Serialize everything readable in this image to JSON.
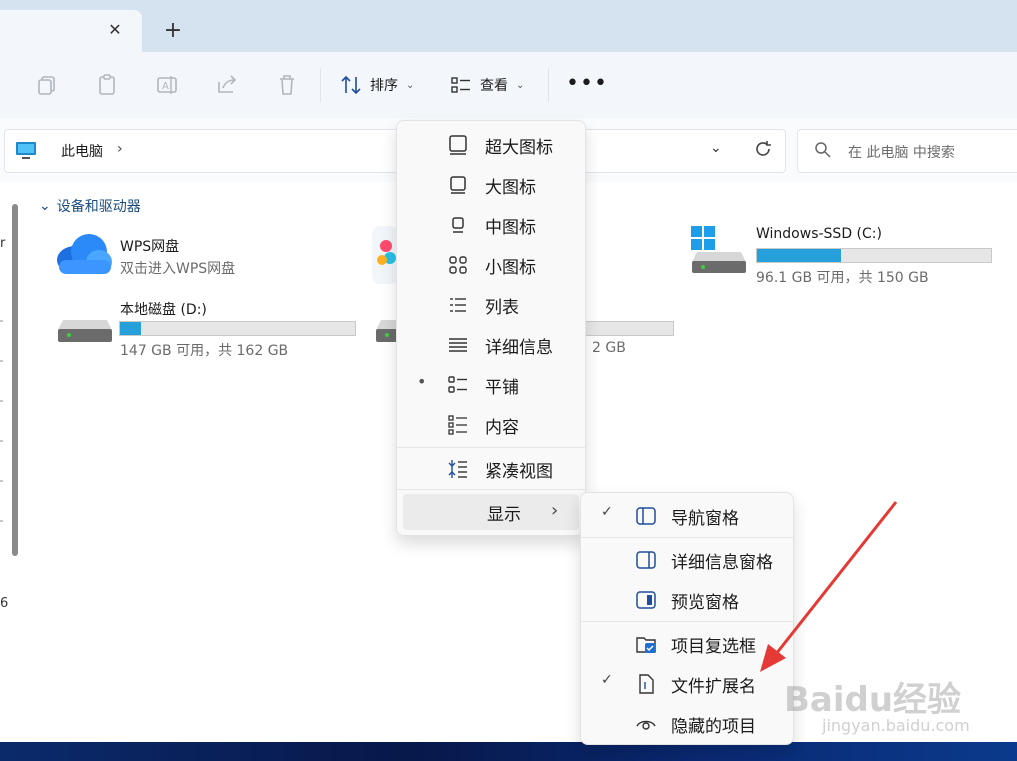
{
  "titlebar": {
    "close_glyph": "✕",
    "new_tab_glyph": "+"
  },
  "toolbar": {
    "sort_label": "排序",
    "view_label": "查看",
    "more_glyph": "•••",
    "chevron": "⌄"
  },
  "address": {
    "crumb": "此电脑",
    "sep": "›",
    "dropdown": "⌄",
    "search_placeholder": "在 此电脑 中搜索"
  },
  "nav": {
    "cut_r": "r",
    "cut_6": "6"
  },
  "content": {
    "group_title": "设备和驱动器",
    "group_chevron": "⌄",
    "items": [
      {
        "name": "WPS网盘",
        "sub": "双击进入WPS网盘"
      },
      {
        "name": "Windows-SSD (C:)",
        "sub": "96.1 GB 可用，共 150 GB",
        "used_fraction": 0.36
      },
      {
        "name": "本地磁盘 (D:)",
        "sub": "147 GB 可用，共 162 GB",
        "used_fraction": 0.09
      },
      {
        "sub_cut": "2 GB",
        "used_fraction": 0.0
      }
    ]
  },
  "view_menu": {
    "items": [
      {
        "label": "超大图标",
        "icon": "extra-large-icons-icon"
      },
      {
        "label": "大图标",
        "icon": "large-icons-icon"
      },
      {
        "label": "中图标",
        "icon": "medium-icons-icon"
      },
      {
        "label": "小图标",
        "icon": "small-icons-icon"
      },
      {
        "label": "列表",
        "icon": "list-icon"
      },
      {
        "label": "详细信息",
        "icon": "details-icon"
      },
      {
        "label": "平铺",
        "icon": "tiles-icon",
        "bullet": "•"
      },
      {
        "label": "内容",
        "icon": "content-icon"
      }
    ],
    "compact_label": "紧凑视图",
    "show_label": "显示",
    "show_arrow": "›"
  },
  "show_menu": {
    "items": [
      {
        "label": "导航窗格",
        "checked": "✓"
      },
      {
        "label": "详细信息窗格"
      },
      {
        "label": "预览窗格"
      },
      {
        "label": "项目复选框"
      },
      {
        "label": "文件扩展名",
        "checked": "✓"
      },
      {
        "label": "隐藏的项目"
      }
    ]
  },
  "watermark": {
    "brand": "Baidu经验",
    "url": "jingyan.baidu.com"
  },
  "colors": {
    "accent": "#26a0da",
    "arrow": "#e53935",
    "link": "#1a4c80"
  }
}
